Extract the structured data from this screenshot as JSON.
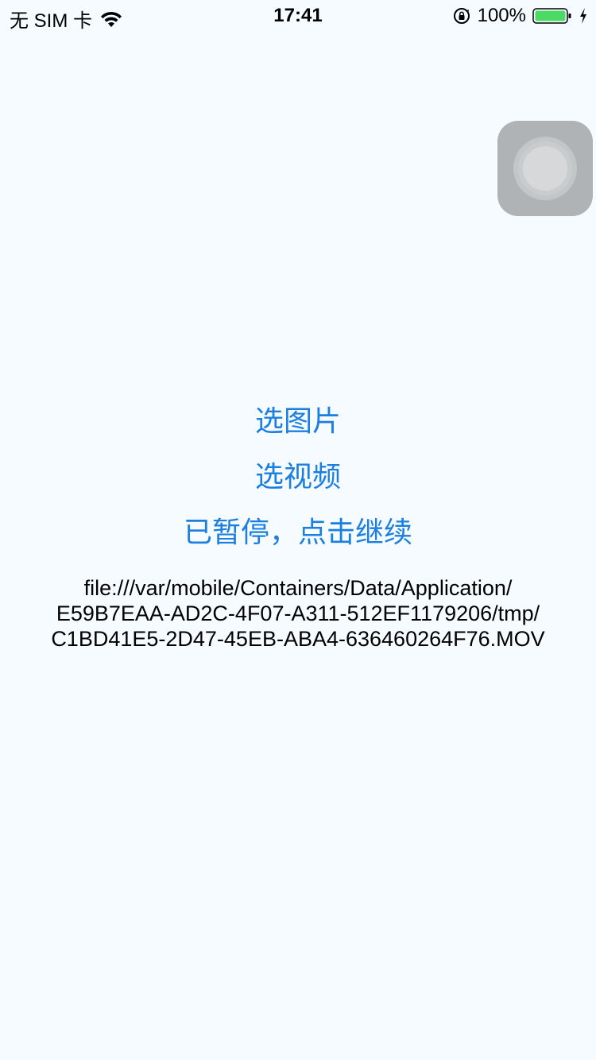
{
  "status_bar": {
    "carrier": "无 SIM 卡",
    "time": "17:41",
    "battery_percent": "100%",
    "battery_level": 1.0,
    "battery_color": "#4cd964",
    "icons": [
      "wifi-icon",
      "orientation-lock-icon",
      "battery-icon",
      "charging-bolt-icon"
    ]
  },
  "buttons": {
    "pick_image": "选图片",
    "pick_video": "选视频",
    "pause_status": "已暂停，点击继续"
  },
  "file_path": {
    "lines": [
      "file:///var/mobile/Containers/Data/Application/",
      "E59B7EAA-AD2C-4F07-A311-512EF1179206/tmp/",
      "C1BD41E5-2D47-45EB-ABA4-636460264F76.MOV"
    ]
  },
  "colors": {
    "background": "#f5fbff",
    "accent": "#1a7fe0"
  }
}
